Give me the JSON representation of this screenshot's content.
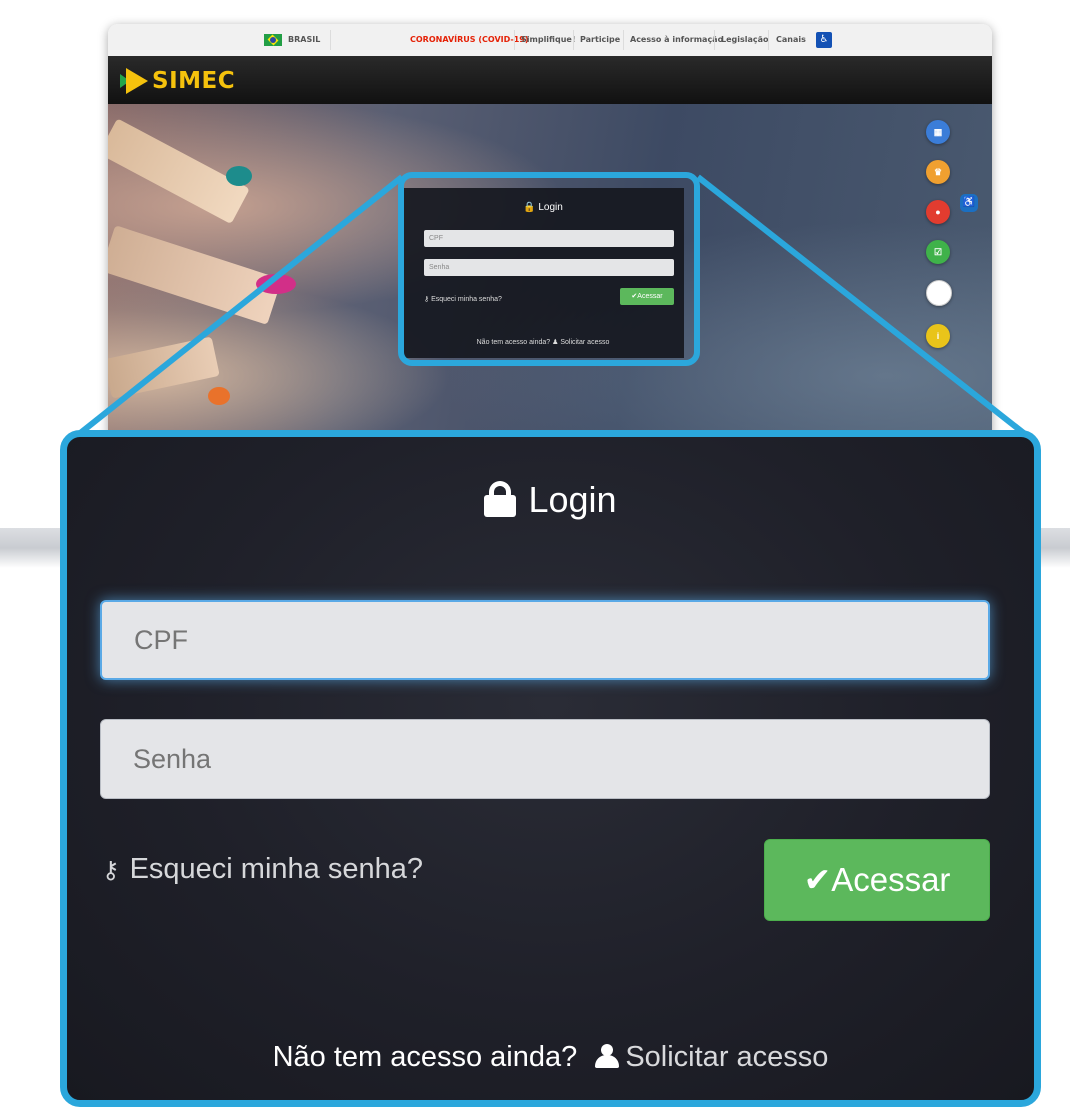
{
  "gov_bar": {
    "country": "BRASIL",
    "links": [
      "CORONAVÍRUS (COVID-19)",
      "Simplifique!",
      "Participe",
      "Acesso à informação",
      "Legislação",
      "Canais"
    ]
  },
  "header": {
    "logo_text": "SIMEC"
  },
  "mini_login": {
    "title": "Login",
    "cpf_placeholder": "CPF",
    "senha_placeholder": "Senha",
    "forgot": "Esqueci minha senha?",
    "submit": "✔Acessar",
    "ask": "Não tem acesso ainda? ♟ Solicitar acesso"
  },
  "side_icons": [
    {
      "name": "apps-icon",
      "color": "#3b7dd8",
      "glyph": "▦"
    },
    {
      "name": "trophy-icon",
      "color": "#f0a030",
      "glyph": "♛"
    },
    {
      "name": "chat-icon",
      "color": "#e23c2f",
      "glyph": "●"
    },
    {
      "name": "checkbox-icon",
      "color": "#3fb24a",
      "glyph": "☑"
    },
    {
      "name": "blank-icon",
      "color": "#ffffff",
      "glyph": ""
    },
    {
      "name": "info-icon",
      "color": "#e9c41a",
      "glyph": "i"
    }
  ],
  "login": {
    "title": "Login",
    "cpf_placeholder": "CPF",
    "senha_placeholder": "Senha",
    "forgot_label": "Esqueci minha senha?",
    "submit_label": "Acessar",
    "no_access_text": "Não tem acesso ainda?",
    "request_label": "Solicitar acesso"
  },
  "colors": {
    "highlight": "#2ba7dc",
    "button": "#5cb85c",
    "logo": "#f5c20d"
  }
}
